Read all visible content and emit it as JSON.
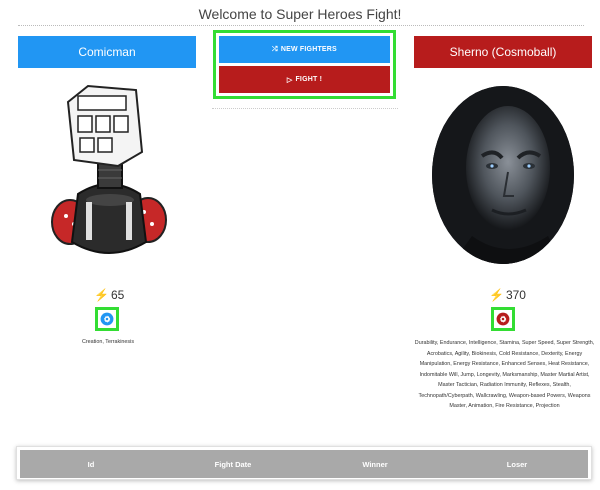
{
  "page": {
    "title": "Welcome to Super Heroes Fight!"
  },
  "actions": {
    "new_fighters_label": "NEW FIGHTERS",
    "fight_label": "FIGHT !",
    "new_fighters_icon": "shuffle-icon",
    "fight_icon": "play-icon"
  },
  "hero": {
    "name": "Comicman",
    "level": "65",
    "type_icon": "gear-icon",
    "powers": "Creation, Terrakinesis",
    "color": "#2196f3"
  },
  "villain": {
    "name": "Sherno (Cosmoball)",
    "level": "370",
    "type_icon": "gear-icon",
    "powers": "Durability, Endurance, Intelligence, Stamina, Super Speed, Super Strength, Acrobatics, Agility, Biokinesis, Cold Resistance, Dexterity, Energy Manipulation, Energy Resistance, Enhanced Senses, Heat Resistance, Indomitable Will, Jump, Longevity, Marksmanship, Master Martial Artist, Master Tactician, Radiation Immunity, Reflexes, Stealth, Technopath/Cyberpath, Wallcrawling, Weapon-based Powers, Weapons Master, Animation, Fire Resistance, Projection",
    "color": "#b71c1c"
  },
  "fights_table": {
    "columns": [
      "Id",
      "Fight Date",
      "Winner",
      "Loser"
    ]
  }
}
